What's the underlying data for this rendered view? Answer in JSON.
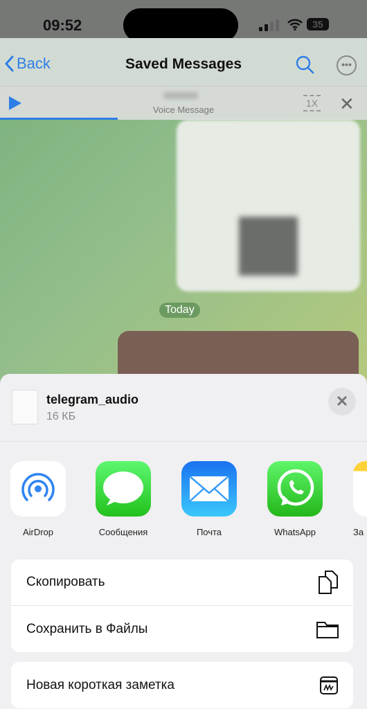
{
  "status": {
    "time": "09:52",
    "battery": "35"
  },
  "nav": {
    "back": "Back",
    "title": "Saved Messages"
  },
  "player": {
    "subtitle": "Voice Message",
    "speed": "1X",
    "progress": 0.32
  },
  "chat": {
    "date_pill": "Today"
  },
  "share": {
    "file_name": "telegram_audio",
    "file_size": "16 КБ",
    "apps": [
      {
        "label": "AirDrop",
        "icon": "airdrop-icon"
      },
      {
        "label": "Сообщения",
        "icon": "messages-icon"
      },
      {
        "label": "Почта",
        "icon": "mail-icon"
      },
      {
        "label": "WhatsApp",
        "icon": "whatsapp-icon"
      },
      {
        "label": "За",
        "icon": "notes-icon"
      }
    ],
    "actions": [
      {
        "label": "Скопировать",
        "icon": "copy-icon"
      },
      {
        "label": "Сохранить в Файлы",
        "icon": "folder-icon"
      }
    ],
    "actions2": [
      {
        "label": "Новая короткая заметка",
        "icon": "quick-note-icon"
      }
    ]
  },
  "colors": {
    "accent": "#2f7ee6",
    "messages": "#34c759",
    "whatsapp": "#25d366"
  }
}
